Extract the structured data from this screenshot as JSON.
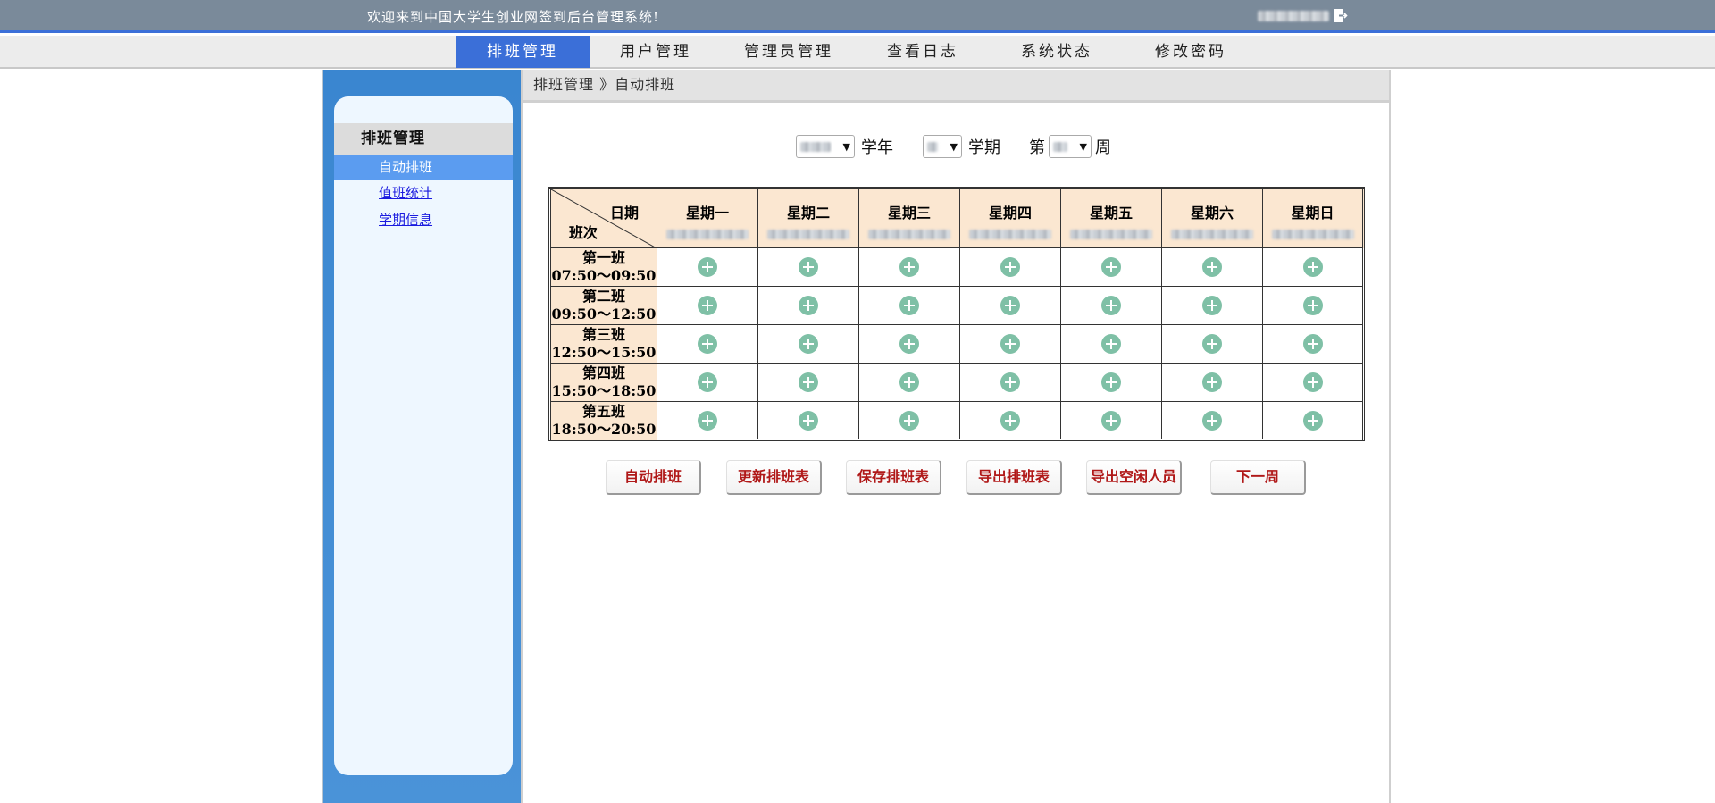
{
  "header": {
    "welcome": "欢迎来到中国大学生创业网签到后台管理系统!",
    "logout_icon": "logout-icon"
  },
  "nav": {
    "items": [
      "排班管理",
      "用户管理",
      "管理员管理",
      "查看日志",
      "系统状态",
      "修改密码"
    ],
    "active": "排班管理"
  },
  "sidebar": {
    "title": "排班管理",
    "items": [
      "自动排班",
      "值班统计",
      "学期信息"
    ]
  },
  "breadcrumb": "排班管理 》自动排班",
  "selectors": {
    "year_label": "学年",
    "term_label": "学期",
    "week_prefix": "第",
    "week_suffix": "周"
  },
  "table": {
    "corner_date": "日期",
    "corner_shift": "班次",
    "days": [
      "星期一",
      "星期二",
      "星期三",
      "星期四",
      "星期五",
      "星期六",
      "星期日"
    ],
    "shifts": [
      {
        "name": "第一班",
        "time": "07:50～09:50"
      },
      {
        "name": "第二班",
        "time": "09:50～12:50"
      },
      {
        "name": "第三班",
        "time": "12:50～15:50"
      },
      {
        "name": "第四班",
        "time": "15:50～18:50"
      },
      {
        "name": "第五班",
        "time": "18:50～20:50"
      }
    ],
    "cell_icon": "add-circle-icon"
  },
  "buttons": [
    "自动排班",
    "更新排班表",
    "保存排班表",
    "导出排班表",
    "导出空闲人员",
    "下一周"
  ],
  "colors": {
    "topbar": "#7a8a9a",
    "nav_active": "#3b6fd8",
    "sidebar": "#3a86d0",
    "header_cell": "#fbe7d1",
    "plus_icon": "#7fc0a6",
    "button_text": "#b01818"
  }
}
